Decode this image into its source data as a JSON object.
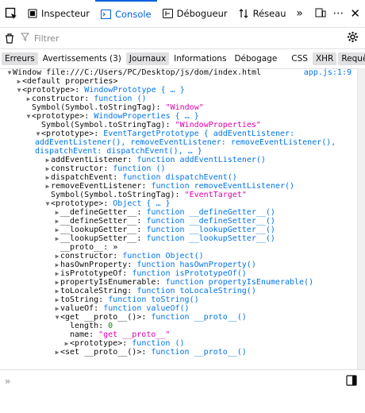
{
  "toolbar": {
    "tabs": [
      {
        "label": "Inspecteur"
      },
      {
        "label": "Console"
      },
      {
        "label": "Débogueur"
      },
      {
        "label": "Réseau"
      }
    ]
  },
  "filter": {
    "placeholder": "Filtrer"
  },
  "categories": [
    "Erreurs",
    "Avertissements (3)",
    "Journaux",
    "Informations",
    "Débogage",
    "CSS",
    "XHR",
    "Requêtes"
  ],
  "console": {
    "source_link": "app.js:1:9",
    "lines": [
      {
        "segs": [
          [
            "k",
            "Window file:///C:/Users/PC/Desktop/js/dom/index.html"
          ]
        ]
      },
      {
        "segs": [
          [
            "k",
            "<default properties>"
          ]
        ]
      },
      {
        "segs": [
          [
            "k",
            "<prototype>: "
          ],
          [
            "f",
            "WindowPrototype { … }"
          ]
        ]
      },
      {
        "segs": [
          [
            "k",
            "constructor: "
          ],
          [
            "f",
            "function ()"
          ]
        ]
      },
      {
        "segs": [
          [
            "k",
            "Symbol(Symbol.toStringTag): "
          ],
          [
            "s",
            "\"Window\""
          ]
        ]
      },
      {
        "segs": [
          [
            "k",
            "<prototype>: "
          ],
          [
            "f",
            "WindowProperties { … }"
          ]
        ]
      },
      {
        "segs": [
          [
            "k",
            "Symbol(Symbol.toStringTag): "
          ],
          [
            "s",
            "\"WindowProperties\""
          ]
        ]
      },
      {
        "segs": [
          [
            "k",
            "<prototype>: "
          ],
          [
            "f",
            "EventTargetPrototype { addEventListener:"
          ]
        ]
      },
      {
        "segs": [
          [
            "f",
            "addEventListener(), removeEventListener: removeEventListener(),"
          ]
        ]
      },
      {
        "segs": [
          [
            "f",
            "dispatchEvent: dispatchEvent(), … }"
          ]
        ]
      },
      {
        "segs": [
          [
            "k",
            "addEventListener: "
          ],
          [
            "f",
            "function addEventListener()"
          ]
        ]
      },
      {
        "segs": [
          [
            "k",
            "constructor: "
          ],
          [
            "f",
            "function ()"
          ]
        ]
      },
      {
        "segs": [
          [
            "k",
            "dispatchEvent: "
          ],
          [
            "f",
            "function dispatchEvent()"
          ]
        ]
      },
      {
        "segs": [
          [
            "k",
            "removeEventListener: "
          ],
          [
            "f",
            "function removeEventListener()"
          ]
        ]
      },
      {
        "segs": [
          [
            "k",
            "Symbol(Symbol.toStringTag): "
          ],
          [
            "s",
            "\"EventTarget\""
          ]
        ]
      },
      {
        "segs": [
          [
            "k",
            "<prototype>: "
          ],
          [
            "f",
            "Object { … }"
          ]
        ]
      },
      {
        "segs": [
          [
            "k",
            "__defineGetter__: "
          ],
          [
            "f",
            "function __defineGetter__()"
          ]
        ]
      },
      {
        "segs": [
          [
            "k",
            "__defineSetter__: "
          ],
          [
            "f",
            "function __defineSetter__()"
          ]
        ]
      },
      {
        "segs": [
          [
            "k",
            "__lookupGetter__: "
          ],
          [
            "f",
            "function __lookupGetter__()"
          ]
        ]
      },
      {
        "segs": [
          [
            "k",
            "__lookupSetter__: "
          ],
          [
            "f",
            "function __lookupSetter__()"
          ]
        ]
      },
      {
        "segs": [
          [
            "k",
            "__proto__: "
          ],
          [
            "k",
            "»"
          ]
        ]
      },
      {
        "segs": [
          [
            "k",
            "constructor: "
          ],
          [
            "f",
            "function Object()"
          ]
        ]
      },
      {
        "segs": [
          [
            "k",
            "hasOwnProperty: "
          ],
          [
            "f",
            "function hasOwnProperty()"
          ]
        ]
      },
      {
        "segs": [
          [
            "k",
            "isPrototypeOf: "
          ],
          [
            "f",
            "function isPrototypeOf()"
          ]
        ]
      },
      {
        "segs": [
          [
            "k",
            "propertyIsEnumerable: "
          ],
          [
            "f",
            "function propertyIsEnumerable()"
          ]
        ]
      },
      {
        "segs": [
          [
            "k",
            "toLocaleString: "
          ],
          [
            "f",
            "function toLocaleString()"
          ]
        ]
      },
      {
        "segs": [
          [
            "k",
            "toString: "
          ],
          [
            "f",
            "function toString()"
          ]
        ]
      },
      {
        "segs": [
          [
            "k",
            "valueOf: "
          ],
          [
            "f",
            "function valueOf()"
          ]
        ]
      },
      {
        "segs": [
          [
            "k",
            "<get __proto__()>: "
          ],
          [
            "f",
            "function __proto__()"
          ]
        ]
      },
      {
        "segs": [
          [
            "k",
            "length: "
          ],
          [
            "n",
            "0"
          ]
        ]
      },
      {
        "segs": [
          [
            "k",
            "name: "
          ],
          [
            "s",
            "\"get __proto__\""
          ]
        ]
      },
      {
        "segs": [
          [
            "k",
            "<prototype>: "
          ],
          [
            "f",
            "function ()"
          ]
        ]
      },
      {
        "segs": [
          [
            "k",
            "<set __proto__()>: "
          ],
          [
            "f",
            "function __proto__()"
          ]
        ]
      }
    ]
  },
  "input": {
    "prompt": "»"
  }
}
